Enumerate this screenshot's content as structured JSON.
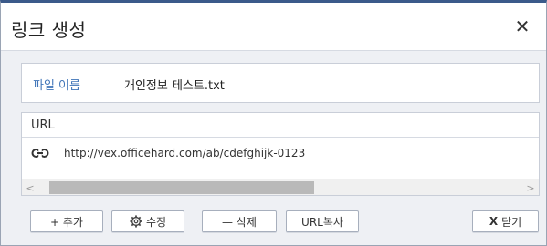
{
  "dialog": {
    "title": "링크 생성",
    "close_symbol": "✕"
  },
  "file": {
    "label": "파일 이름",
    "value": "개인정보 테스트.txt"
  },
  "url_panel": {
    "header": "URL",
    "url": "http://vex.officehard.com/ab/cdefghijk-0123",
    "link_icon": "link-icon",
    "scroll_left": "<",
    "scroll_right": ">"
  },
  "buttons": {
    "add": "+ 추가",
    "edit": "수정",
    "delete": "— 삭제",
    "copy_url": "URL복사",
    "close_x": "X",
    "close_label": "닫기"
  },
  "colors": {
    "accent": "#3b5a8a",
    "file_label": "#3f74b8"
  }
}
